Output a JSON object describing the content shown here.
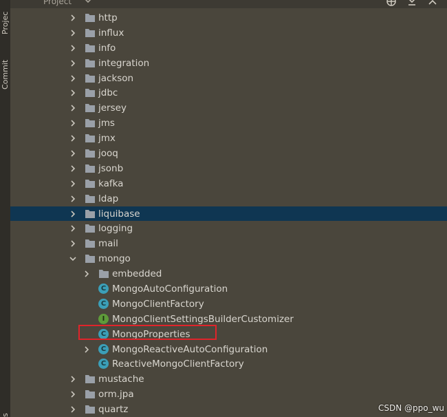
{
  "header": {
    "title": "Project"
  },
  "side_tabs": {
    "project": "Projec",
    "commit": "Commit",
    "bottom": "s"
  },
  "tree": [
    {
      "label": "http",
      "kind": "folder",
      "depth": 0,
      "expanded": false
    },
    {
      "label": "influx",
      "kind": "folder",
      "depth": 0,
      "expanded": false
    },
    {
      "label": "info",
      "kind": "folder",
      "depth": 0,
      "expanded": false
    },
    {
      "label": "integration",
      "kind": "folder",
      "depth": 0,
      "expanded": false
    },
    {
      "label": "jackson",
      "kind": "folder",
      "depth": 0,
      "expanded": false
    },
    {
      "label": "jdbc",
      "kind": "folder",
      "depth": 0,
      "expanded": false
    },
    {
      "label": "jersey",
      "kind": "folder",
      "depth": 0,
      "expanded": false
    },
    {
      "label": "jms",
      "kind": "folder",
      "depth": 0,
      "expanded": false
    },
    {
      "label": "jmx",
      "kind": "folder",
      "depth": 0,
      "expanded": false
    },
    {
      "label": "jooq",
      "kind": "folder",
      "depth": 0,
      "expanded": false
    },
    {
      "label": "jsonb",
      "kind": "folder",
      "depth": 0,
      "expanded": false
    },
    {
      "label": "kafka",
      "kind": "folder",
      "depth": 0,
      "expanded": false
    },
    {
      "label": "ldap",
      "kind": "folder",
      "depth": 0,
      "expanded": false
    },
    {
      "label": "liquibase",
      "kind": "folder",
      "depth": 0,
      "expanded": false,
      "selected": true
    },
    {
      "label": "logging",
      "kind": "folder",
      "depth": 0,
      "expanded": false
    },
    {
      "label": "mail",
      "kind": "folder",
      "depth": 0,
      "expanded": false
    },
    {
      "label": "mongo",
      "kind": "folder",
      "depth": 0,
      "expanded": true
    },
    {
      "label": "embedded",
      "kind": "folder",
      "depth": 1,
      "expanded": false
    },
    {
      "label": "MongoAutoConfiguration",
      "kind": "class",
      "badge": "C",
      "depth": 1
    },
    {
      "label": "MongoClientFactory",
      "kind": "class",
      "badge": "C",
      "depth": 1
    },
    {
      "label": "MongoClientSettingsBuilderCustomizer",
      "kind": "interface",
      "badge": "I",
      "depth": 1
    },
    {
      "label": "MongoProperties",
      "kind": "class",
      "badge": "C",
      "depth": 1,
      "highlighted": true
    },
    {
      "label": "MongoReactiveAutoConfiguration",
      "kind": "class",
      "badge": "C",
      "depth": 1,
      "has_children": true
    },
    {
      "label": "ReactiveMongoClientFactory",
      "kind": "class",
      "badge": "C",
      "depth": 1
    },
    {
      "label": "mustache",
      "kind": "folder",
      "depth": 0,
      "expanded": false
    },
    {
      "label": "orm.jpa",
      "kind": "folder",
      "depth": 0,
      "expanded": false
    },
    {
      "label": "quartz",
      "kind": "folder",
      "depth": 0,
      "expanded": false
    }
  ],
  "watermark": "CSDN @ppo_wu",
  "colors": {
    "background": "#4a463c",
    "selection": "#0f3652",
    "text": "#d9d6cf",
    "folder": "#9aa0a8",
    "class_badge": "#3b9fb8",
    "interface_badge": "#5e9b3a",
    "highlight_border": "#e0242a"
  }
}
